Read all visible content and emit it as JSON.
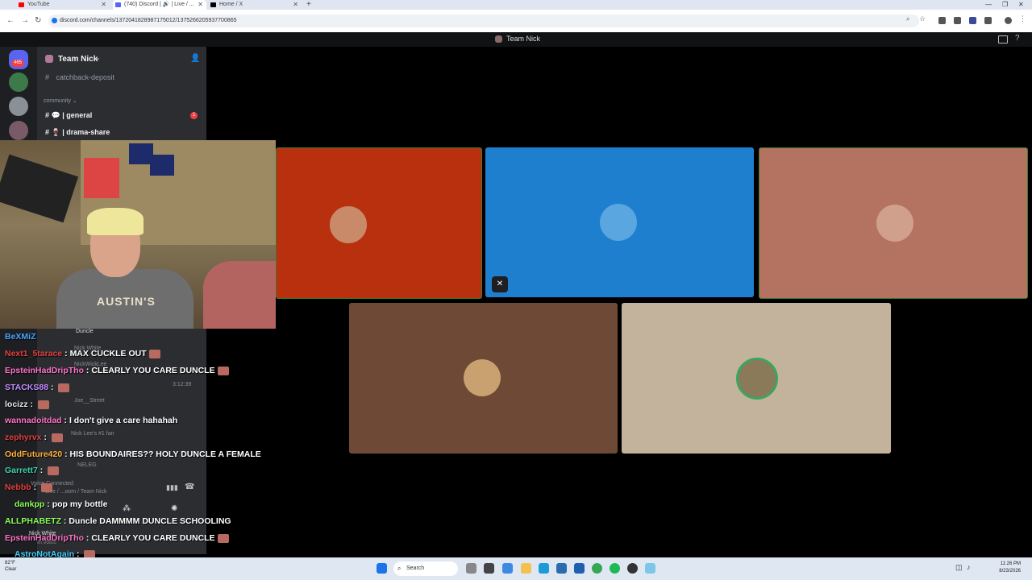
{
  "browser": {
    "tabs": [
      {
        "label": "YouTube",
        "color": "#ff0000"
      },
      {
        "label": "(740) Discord | 🔊 | Live / ... ",
        "color": "#5865f2"
      },
      {
        "label": "Home / X",
        "color": "#000000"
      }
    ],
    "url": "discord.com/channels/1372041828987175012/1375266205937700865"
  },
  "discord": {
    "top_title": "Team Nick",
    "rail_badge": "465",
    "server_name": "Team Nick",
    "channels": [
      {
        "name": "catchback-deposit"
      },
      {
        "name": "general",
        "badge": "1"
      },
      {
        "name": "drama-share"
      }
    ],
    "category": "community",
    "voice_users": [
      "Duncle",
      "Nick White",
      "NickWickLee",
      "Joe__Street",
      "Nick Lee's #1 fan",
      "NELEG"
    ],
    "voice_timer": "3:12:39",
    "voice_status": "Voice Connected",
    "voice_channel": "Live / ...oom / Team Nick",
    "self_name": "Nick White",
    "self_status": "In voice",
    "tiles": [
      {
        "bg": "#b9300f"
      },
      {
        "bg": "#1f7fcf"
      },
      {
        "bg": "#b47260"
      },
      {
        "bg": "#6e4a36"
      },
      {
        "bg": "#c4b39c"
      }
    ]
  },
  "webcam": {
    "shirt_text": "AUSTIN'S"
  },
  "chat": [
    {
      "user": "BeXMiZ",
      "text": "",
      "color": "#4aa3ff"
    },
    {
      "user": "Next1_5tarace",
      "text": "MAX CUCKLE OUT",
      "color": "#e04040"
    },
    {
      "user": "EpsteinHadDripTho",
      "text": "CLEARLY YOU CARE DUNCLE",
      "color": "#ff73c8"
    },
    {
      "user": "STACKS88",
      "text": "",
      "color": "#c08cff"
    },
    {
      "user": "locizz",
      "text": "",
      "color": "#e6e6e6"
    },
    {
      "user": "wannadoitdad",
      "text": "I don't give a care hahahah",
      "color": "#ff73c8"
    },
    {
      "user": "zephyrvx",
      "text": "",
      "color": "#e04040"
    },
    {
      "user": "OddFuture420",
      "text": "HIS BOUNDAIRES?? HOLY DUNCLE A FEMALE",
      "color": "#ffb03a"
    },
    {
      "user": "Garrett7",
      "text": "",
      "color": "#40d0b0"
    },
    {
      "user": "Nebbb",
      "text": "",
      "color": "#e04040"
    },
    {
      "user": "dankpp",
      "text": "pop my bottle",
      "color": "#8cff5a"
    },
    {
      "user": "ALLPHABETZ",
      "text": "Duncle DAMMMM DUNCLE SCHOOLING",
      "color": "#8cff5a"
    },
    {
      "user": "EpsteinHadDripTho",
      "text": "CLEARLY YOU CARE DUNCLE",
      "color": "#ff73c8"
    },
    {
      "user": "AstroNotAgain",
      "text": "",
      "color": "#40d0ff"
    }
  ],
  "taskbar": {
    "search_placeholder": "Search",
    "time": "11:26 PM",
    "date": "8/23/2026",
    "weather_temp": "82°F",
    "weather_text": "Clear"
  }
}
